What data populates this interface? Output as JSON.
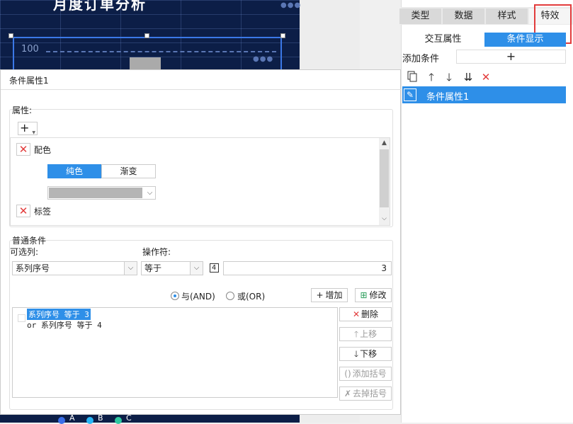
{
  "chart_preview": {
    "title": "月度订单分析",
    "axis_tick": "100",
    "legend": [
      "A",
      "B",
      "C"
    ],
    "legend_colors": [
      "#3a6ee8",
      "#29b6f6",
      "#2ec7a0"
    ]
  },
  "right_panel": {
    "tabs": [
      {
        "label": "类型"
      },
      {
        "label": "数据"
      },
      {
        "label": "样式"
      },
      {
        "label": "特效"
      }
    ],
    "subtabs": {
      "interaction": "交互属性",
      "condition": "条件显示"
    },
    "add_condition_label": "添加条件",
    "add_condition_button": "+",
    "toolbar_icons": [
      "copy-icon",
      "arrow-up-icon",
      "arrow-down-icon",
      "move-to-bottom-icon",
      "delete-icon"
    ],
    "condition_items": [
      {
        "label": "条件属性1"
      }
    ],
    "accent_color": "#2e8fe8",
    "highlight_color": "#e23c3c"
  },
  "dialog": {
    "title": "条件属性1",
    "attributes": {
      "group_label": "属性:",
      "add_button": "+",
      "items": [
        {
          "label": "配色"
        },
        {
          "label": "标签"
        }
      ],
      "color_modes": [
        "纯色",
        "渐变"
      ],
      "selected_color": "#b5b5b5"
    },
    "conditions": {
      "group_label": "普通条件",
      "column_label": "可选列:",
      "operator_label": "操作符:",
      "column_value": "系列序号",
      "operator_value": "等于",
      "value_type": "4",
      "value": "3",
      "radio_and": "与(AND)",
      "radio_or": "或(OR)",
      "add_button": "增加",
      "modify_button": "修改",
      "lines": [
        "系列序号 等于 3",
        "or  系列序号 等于 4"
      ],
      "side_buttons": [
        "删除",
        "上移",
        "下移",
        "添加括号",
        "去掉括号"
      ]
    }
  }
}
